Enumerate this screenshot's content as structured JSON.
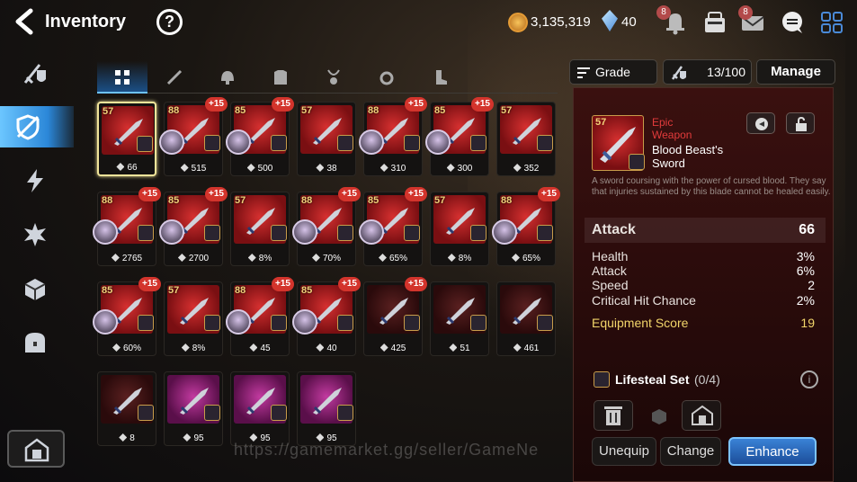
{
  "header": {
    "title": "Inventory",
    "help_label": "?",
    "gold": "3,135,319",
    "crystals": "40",
    "bell_badge": "8",
    "mail_badge": "8"
  },
  "sidebar": {
    "items": [
      {
        "icon": "gear-sword-icon"
      },
      {
        "icon": "gear-shield-icon",
        "active": true
      },
      {
        "icon": "artifact-icon"
      },
      {
        "icon": "catalyst-icon"
      },
      {
        "icon": "material-icon"
      },
      {
        "icon": "chest-icon"
      }
    ]
  },
  "tabs": [
    "all-icon",
    "weapon-icon",
    "helmet-icon",
    "armor-icon",
    "necklace-icon",
    "ring-icon",
    "boots-icon"
  ],
  "grid_items": [
    {
      "level": "57",
      "plus": "",
      "stat": "66",
      "hero": false,
      "selected": true,
      "art": "red"
    },
    {
      "level": "88",
      "plus": "+15",
      "stat": "515",
      "hero": true,
      "art": "red"
    },
    {
      "level": "85",
      "plus": "+15",
      "stat": "500",
      "hero": true,
      "art": "red"
    },
    {
      "level": "57",
      "plus": "",
      "stat": "38",
      "hero": false,
      "art": "red"
    },
    {
      "level": "88",
      "plus": "+15",
      "stat": "310",
      "hero": true,
      "art": "red"
    },
    {
      "level": "85",
      "plus": "+15",
      "stat": "300",
      "hero": true,
      "art": "red"
    },
    {
      "level": "57",
      "plus": "",
      "stat": "352",
      "hero": false,
      "art": "red"
    },
    {
      "level": "88",
      "plus": "+15",
      "stat": "2765",
      "hero": true,
      "art": "red"
    },
    {
      "level": "85",
      "plus": "+15",
      "stat": "2700",
      "hero": true,
      "art": "red"
    },
    {
      "level": "57",
      "plus": "",
      "stat": "8%",
      "hero": false,
      "art": "red"
    },
    {
      "level": "88",
      "plus": "+15",
      "stat": "70%",
      "hero": true,
      "art": "red"
    },
    {
      "level": "85",
      "plus": "+15",
      "stat": "65%",
      "hero": true,
      "art": "red"
    },
    {
      "level": "57",
      "plus": "",
      "stat": "8%",
      "hero": false,
      "art": "red"
    },
    {
      "level": "88",
      "plus": "+15",
      "stat": "65%",
      "hero": true,
      "art": "red"
    },
    {
      "level": "85",
      "plus": "+15",
      "stat": "60%",
      "hero": true,
      "art": "red"
    },
    {
      "level": "57",
      "plus": "",
      "stat": "8%",
      "hero": false,
      "art": "red"
    },
    {
      "level": "88",
      "plus": "+15",
      "stat": "45",
      "hero": true,
      "art": "red"
    },
    {
      "level": "85",
      "plus": "+15",
      "stat": "40",
      "hero": true,
      "art": "red"
    },
    {
      "level": "",
      "plus": "+15",
      "stat": "425",
      "hero": false,
      "art": "dark"
    },
    {
      "level": "",
      "plus": "",
      "stat": "51",
      "hero": false,
      "art": "dark"
    },
    {
      "level": "",
      "plus": "",
      "stat": "461",
      "hero": false,
      "art": "dark"
    },
    {
      "level": "",
      "plus": "",
      "stat": "8",
      "hero": false,
      "art": "dark"
    },
    {
      "level": "",
      "plus": "",
      "stat": "95",
      "hero": false,
      "art": "purple"
    },
    {
      "level": "",
      "plus": "",
      "stat": "95",
      "hero": false,
      "art": "purple"
    },
    {
      "level": "",
      "plus": "",
      "stat": "95",
      "hero": false,
      "art": "purple"
    }
  ],
  "controls": {
    "grade": "Grade",
    "capacity": "13/100",
    "manage": "Manage"
  },
  "detail": {
    "level": "57",
    "rarity": "Epic",
    "type": "Weapon",
    "name_line1": "Blood Beast's",
    "name_line2": "Sword",
    "description": "A sword coursing with the power of cursed blood. They say that injuries sustained by this blade cannot be healed easily.",
    "main_stat": {
      "label": "Attack",
      "value": "66"
    },
    "substats": [
      {
        "label": "Health",
        "value": "3%"
      },
      {
        "label": "Attack",
        "value": "6%"
      },
      {
        "label": "Speed",
        "value": "2"
      },
      {
        "label": "Critical Hit Chance",
        "value": "2%"
      }
    ],
    "score": {
      "label": "Equipment Score",
      "value": "19"
    },
    "set_name": "Lifesteal Set",
    "set_count": "(0/4)",
    "buttons": {
      "unequip": "Unequip",
      "change": "Change",
      "enhance": "Enhance"
    }
  },
  "watermark": "https://gamemarket.gg/seller/GameNe",
  "colors": {
    "accent": "#2b87d8",
    "epic": "#e23b3b",
    "score": "#f2d56a",
    "plus": "#d3342c"
  }
}
